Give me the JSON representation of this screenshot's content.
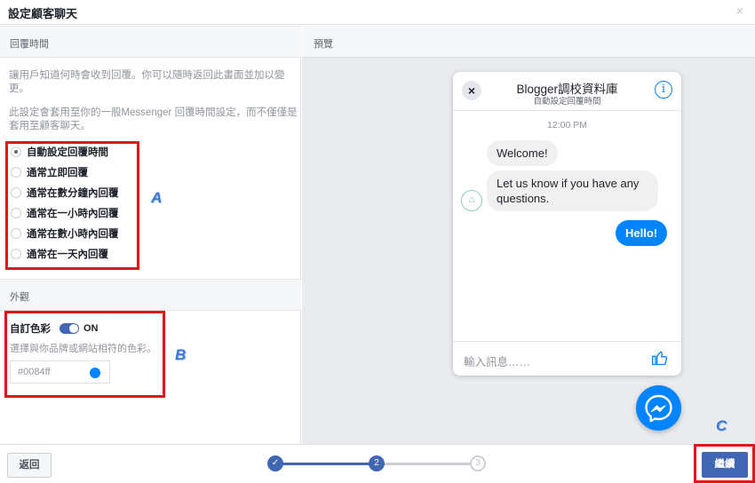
{
  "dialog": {
    "title": "設定顧客聊天",
    "close_symbol": "×"
  },
  "reply_section": {
    "header": "回覆時間",
    "desc1": "讓用戶知道何時會收到回覆。你可以隨時返回此畫面並加以變更。",
    "desc2": "此設定會套用至你的一般Messenger 回覆時間設定，而不僅僅是套用至顧客聊天。",
    "options": [
      {
        "label": "自動設定回覆時間",
        "selected": true
      },
      {
        "label": "通常立即回覆",
        "selected": false
      },
      {
        "label": "通常在數分鐘內回覆",
        "selected": false
      },
      {
        "label": "通常在一小時內回覆",
        "selected": false
      },
      {
        "label": "通常在數小時內回覆",
        "selected": false
      },
      {
        "label": "通常在一天內回覆",
        "selected": false
      }
    ]
  },
  "appearance_section": {
    "header": "外觀",
    "custom_color_label": "自訂色彩",
    "toggle_state": "ON",
    "hint": "選擇與你品牌或網站相符的色彩。",
    "color_value": "#0084ff",
    "accent_color": "#0084ff"
  },
  "annotations": {
    "a": "A",
    "b": "B",
    "c": "C"
  },
  "preview": {
    "header": "預覽",
    "chat_title": "Blogger調校資料庫",
    "chat_subtitle": "自動設定回覆時間",
    "close_symbol": "×",
    "info_symbol": "i",
    "time": "12:00 PM",
    "messages": [
      {
        "text": "Welcome!",
        "from": "page"
      },
      {
        "text": "Let us know if you have any questions.",
        "from": "page"
      },
      {
        "text": "Hello!",
        "from": "user"
      }
    ],
    "input_placeholder": "輸入訊息……",
    "like_icon": "thumbs-up-icon"
  },
  "footer": {
    "back_label": "返回",
    "next_label": "繼續",
    "steps": [
      {
        "label": "✓",
        "state": "done"
      },
      {
        "label": "2",
        "state": "current"
      },
      {
        "label": "3",
        "state": "todo"
      }
    ]
  }
}
